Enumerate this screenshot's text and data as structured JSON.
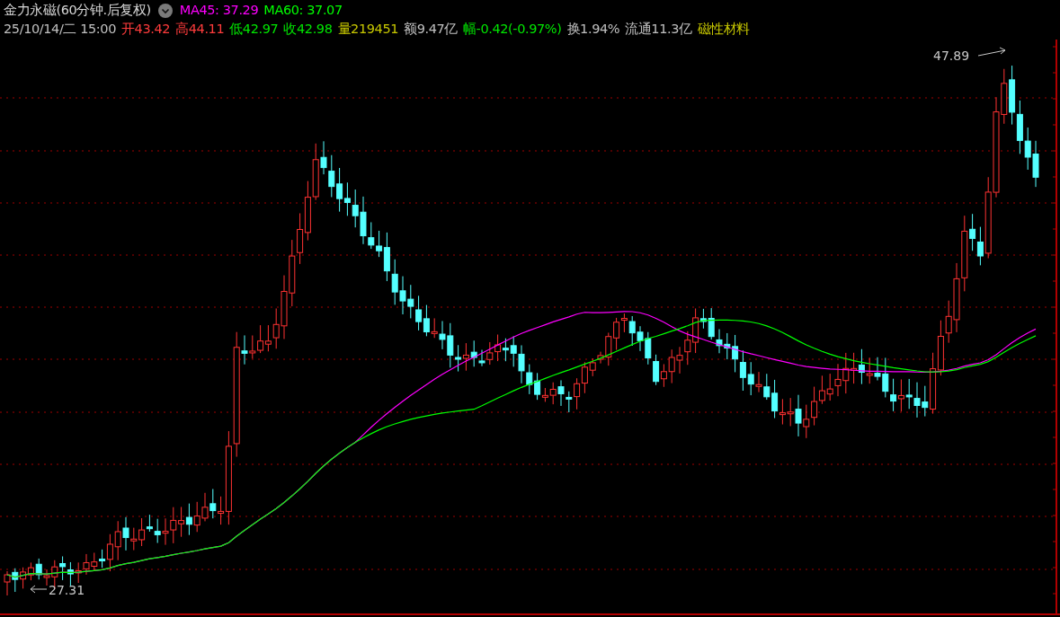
{
  "title": "金力永磁(60分钟.后复权)",
  "indicators": [
    {
      "label": "MA45: 37.29",
      "color": "#ff00ff"
    },
    {
      "label": "MA60: 37.07",
      "color": "#00ff00"
    }
  ],
  "quote": [
    {
      "label": "25/10/14/二 15:00",
      "color": "#c0c0c0"
    },
    {
      "label": "开43.42",
      "color": "#ff3c3c"
    },
    {
      "label": "高44.11",
      "color": "#ff3c3c"
    },
    {
      "label": "低42.97",
      "color": "#00e600"
    },
    {
      "label": "收42.98",
      "color": "#00e600"
    },
    {
      "label": "量219451",
      "color": "#c8c800"
    },
    {
      "label": "额9.47亿",
      "color": "#c0c0c0"
    },
    {
      "label": "幅-0.42(-0.97%)",
      "color": "#00e600"
    },
    {
      "label": "换1.94%",
      "color": "#c0c0c0"
    },
    {
      "label": "流通11.3亿",
      "color": "#c0c0c0"
    },
    {
      "label": "磁性材料",
      "color": "#c8c800"
    }
  ],
  "chart": {
    "high_label": "47.89",
    "low_label": "27.31"
  }
}
